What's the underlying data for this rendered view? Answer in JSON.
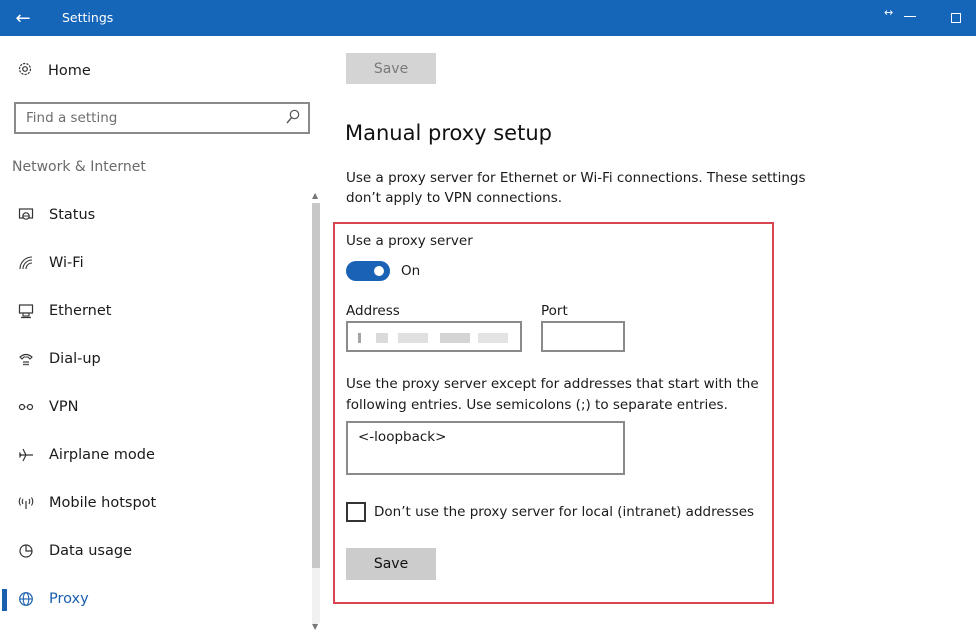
{
  "titlebar": {
    "title": "Settings",
    "back_glyph": "←",
    "resize_glyph": "↔"
  },
  "sidebar": {
    "home_label": "Home",
    "search_placeholder": "Find a setting",
    "group_label": "Network & Internet",
    "items": [
      {
        "label": "Status",
        "icon": "globe-icon"
      },
      {
        "label": "Wi-Fi",
        "icon": "wifi-icon"
      },
      {
        "label": "Ethernet",
        "icon": "ethernet-icon"
      },
      {
        "label": "Dial-up",
        "icon": "dialup-icon"
      },
      {
        "label": "VPN",
        "icon": "vpn-icon"
      },
      {
        "label": "Airplane mode",
        "icon": "airplane-icon"
      },
      {
        "label": "Mobile hotspot",
        "icon": "hotspot-icon"
      },
      {
        "label": "Data usage",
        "icon": "data-usage-icon"
      },
      {
        "label": "Proxy",
        "icon": "globe-icon",
        "active": true
      }
    ]
  },
  "main": {
    "save_top_label": "Save",
    "title": "Manual proxy setup",
    "description": "Use a proxy server for Ethernet or Wi-Fi connections. These settings don’t apply to VPN connections.",
    "use_proxy_label": "Use a proxy server",
    "toggle_state": "On",
    "address_label": "Address",
    "address_value": "",
    "port_label": "Port",
    "port_value": "",
    "exceptions_text": "Use the proxy server except for addresses that start with the following entries. Use semicolons (;) to separate entries.",
    "exceptions_value": "<-loopback>",
    "local_checkbox_label": "Don’t use the proxy server for local (intranet) addresses",
    "save_bottom_label": "Save"
  },
  "colors": {
    "accent": "#1a62b5",
    "titlebar": "#1565b8",
    "highlight_border": "#d9454e"
  }
}
